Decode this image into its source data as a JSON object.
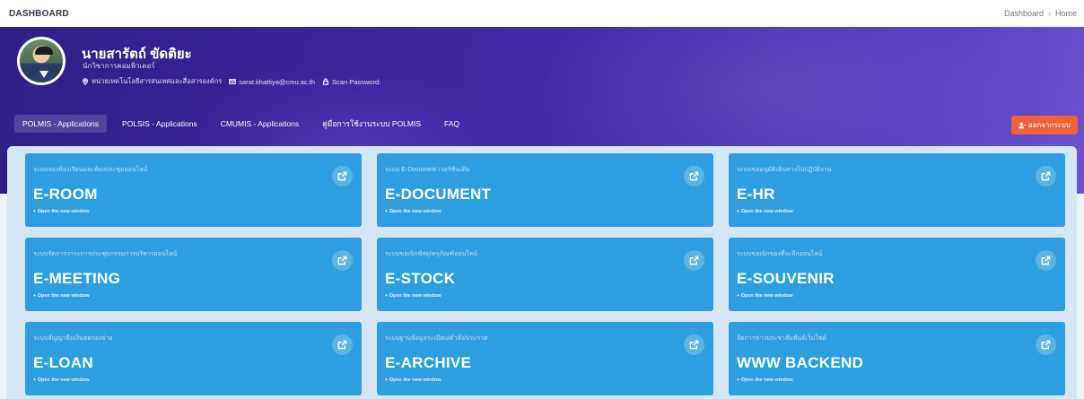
{
  "topbar": {
    "title": "DASHBOARD",
    "breadcrumb": [
      "Dashboard",
      "Home"
    ],
    "separator": "›"
  },
  "profile": {
    "name": "นายสารัตถ์ ขัดติยะ",
    "role": "นักวิชาการคอมพิวเตอร์",
    "unit": "หน่วยเทคโนโลยีสารสนเทศและสื่อสารองค์กร",
    "email": "sarat.khattiya@cmu.ac.th",
    "scan_label": "Scan Password:"
  },
  "tabs": [
    {
      "label": "POLMIS - Applications",
      "active": true
    },
    {
      "label": "POLSIS - Applications",
      "active": false
    },
    {
      "label": "CMUMIS - Applications",
      "active": false
    },
    {
      "label": "คู่มือการใช้งานระบบ POLMIS",
      "active": false
    },
    {
      "label": "FAQ",
      "active": false
    }
  ],
  "logout_label": "ออกจากระบบ",
  "colors": {
    "hero_start": "#2f1f86",
    "hero_end": "#6a52d0",
    "card": "#2d9fe0",
    "logout": "#f0623a"
  },
  "cards": [
    {
      "subtitle": "ระบบจองห้องเรียนและห้องประชุมออนไลน์",
      "title": "E-ROOM",
      "open": "+ Open the new window"
    },
    {
      "subtitle": "ระบบ E-Document เวอร์ชันเดิม",
      "title": "E-DOCUMENT",
      "open": "+ Open the new window"
    },
    {
      "subtitle": "ระบบขออนุมัติเดินทางไปปฏิบัติงาน",
      "title": "E-HR",
      "open": "+ Open the new window"
    },
    {
      "subtitle": "ระบบจัดการวาระการประชุมกรรมการบริหารออนไลน์",
      "title": "E-MEETING",
      "open": "+ Open the new window"
    },
    {
      "subtitle": "ระบบขอเบิกพัสดุ/ครุภัณฑ์ออนไลน์",
      "title": "E-STOCK",
      "open": "+ Open the new window"
    },
    {
      "subtitle": "ระบบขอเบิกของที่ระลึกออนไลน์",
      "title": "E-SOUVENIR",
      "open": "+ Open the new window"
    },
    {
      "subtitle": "ระบบสัญญายืมเงินทดรองจ่าย",
      "title": "E-LOAN",
      "open": "+ Open the new window"
    },
    {
      "subtitle": "ระบบฐานข้อมูลระเบียบ/คำสั่ง/ประกาศ",
      "title": "E-ARCHIVE",
      "open": "+ Open the new window"
    },
    {
      "subtitle": "จัดการข่าวประชาสัมพันธ์เว็บไซต์",
      "title": "WWW BACKEND",
      "open": "+ Open the new window"
    }
  ]
}
